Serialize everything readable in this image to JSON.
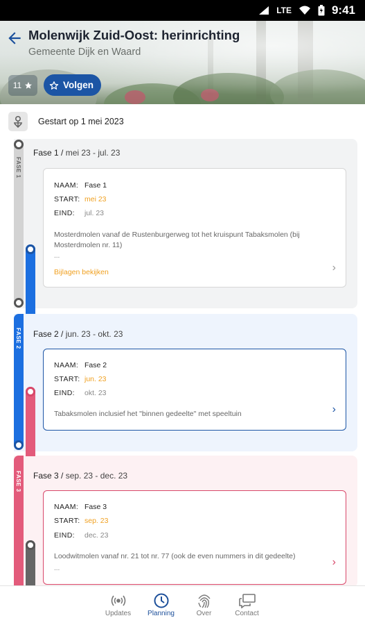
{
  "status": {
    "network": "LTE",
    "time": "9:41"
  },
  "header": {
    "title": "Molenwijk Zuid-Oost: herinrichting",
    "subtitle": "Gemeente Dijk en Waard",
    "followers_count": "11",
    "follow_label": "Volgen"
  },
  "started": "Gestart op 1 mei 2023",
  "field_labels": {
    "name": "NAAM:",
    "start": "START:",
    "end": "EIND:"
  },
  "phases": [
    {
      "rail_label": "FASE 1",
      "head_name": "Fase 1",
      "head_range": "mei 23 - jul. 23",
      "name": "Fase 1",
      "start": "mei 23",
      "end": "jul. 23",
      "description": "Mosterdmolen vanaf de Rustenburgerweg tot het kruispunt Tabaksmolen (bij Mosterdmolen nr. 11)",
      "more": "...",
      "attachments": "Bijlagen bekijken",
      "color": "#c8c8c8"
    },
    {
      "rail_label": "FASE 2",
      "head_name": "Fase 2",
      "head_range": "jun. 23 - okt. 23",
      "name": "Fase 2",
      "start": "jun. 23",
      "end": "okt. 23",
      "description": "Tabaksmolen inclusief het \"binnen gedeelte\" met speeltuin",
      "color": "#1c6fe0"
    },
    {
      "rail_label": "FASE 3",
      "head_name": "Fase 3",
      "head_range": "sep. 23 - dec. 23",
      "name": "Fase 3",
      "start": "sep. 23",
      "end": "dec. 23",
      "description": "Loodwitmolen vanaf nr. 21 tot nr. 77 (ook de even nummers in dit gedeelte)",
      "more": "...",
      "color": "#e35b7b"
    }
  ],
  "nav": [
    {
      "label": "Updates",
      "icon": "broadcast-icon"
    },
    {
      "label": "Planning",
      "icon": "clock-icon",
      "active": true
    },
    {
      "label": "Over",
      "icon": "fingerprint-icon"
    },
    {
      "label": "Contact",
      "icon": "chat-icon"
    }
  ]
}
